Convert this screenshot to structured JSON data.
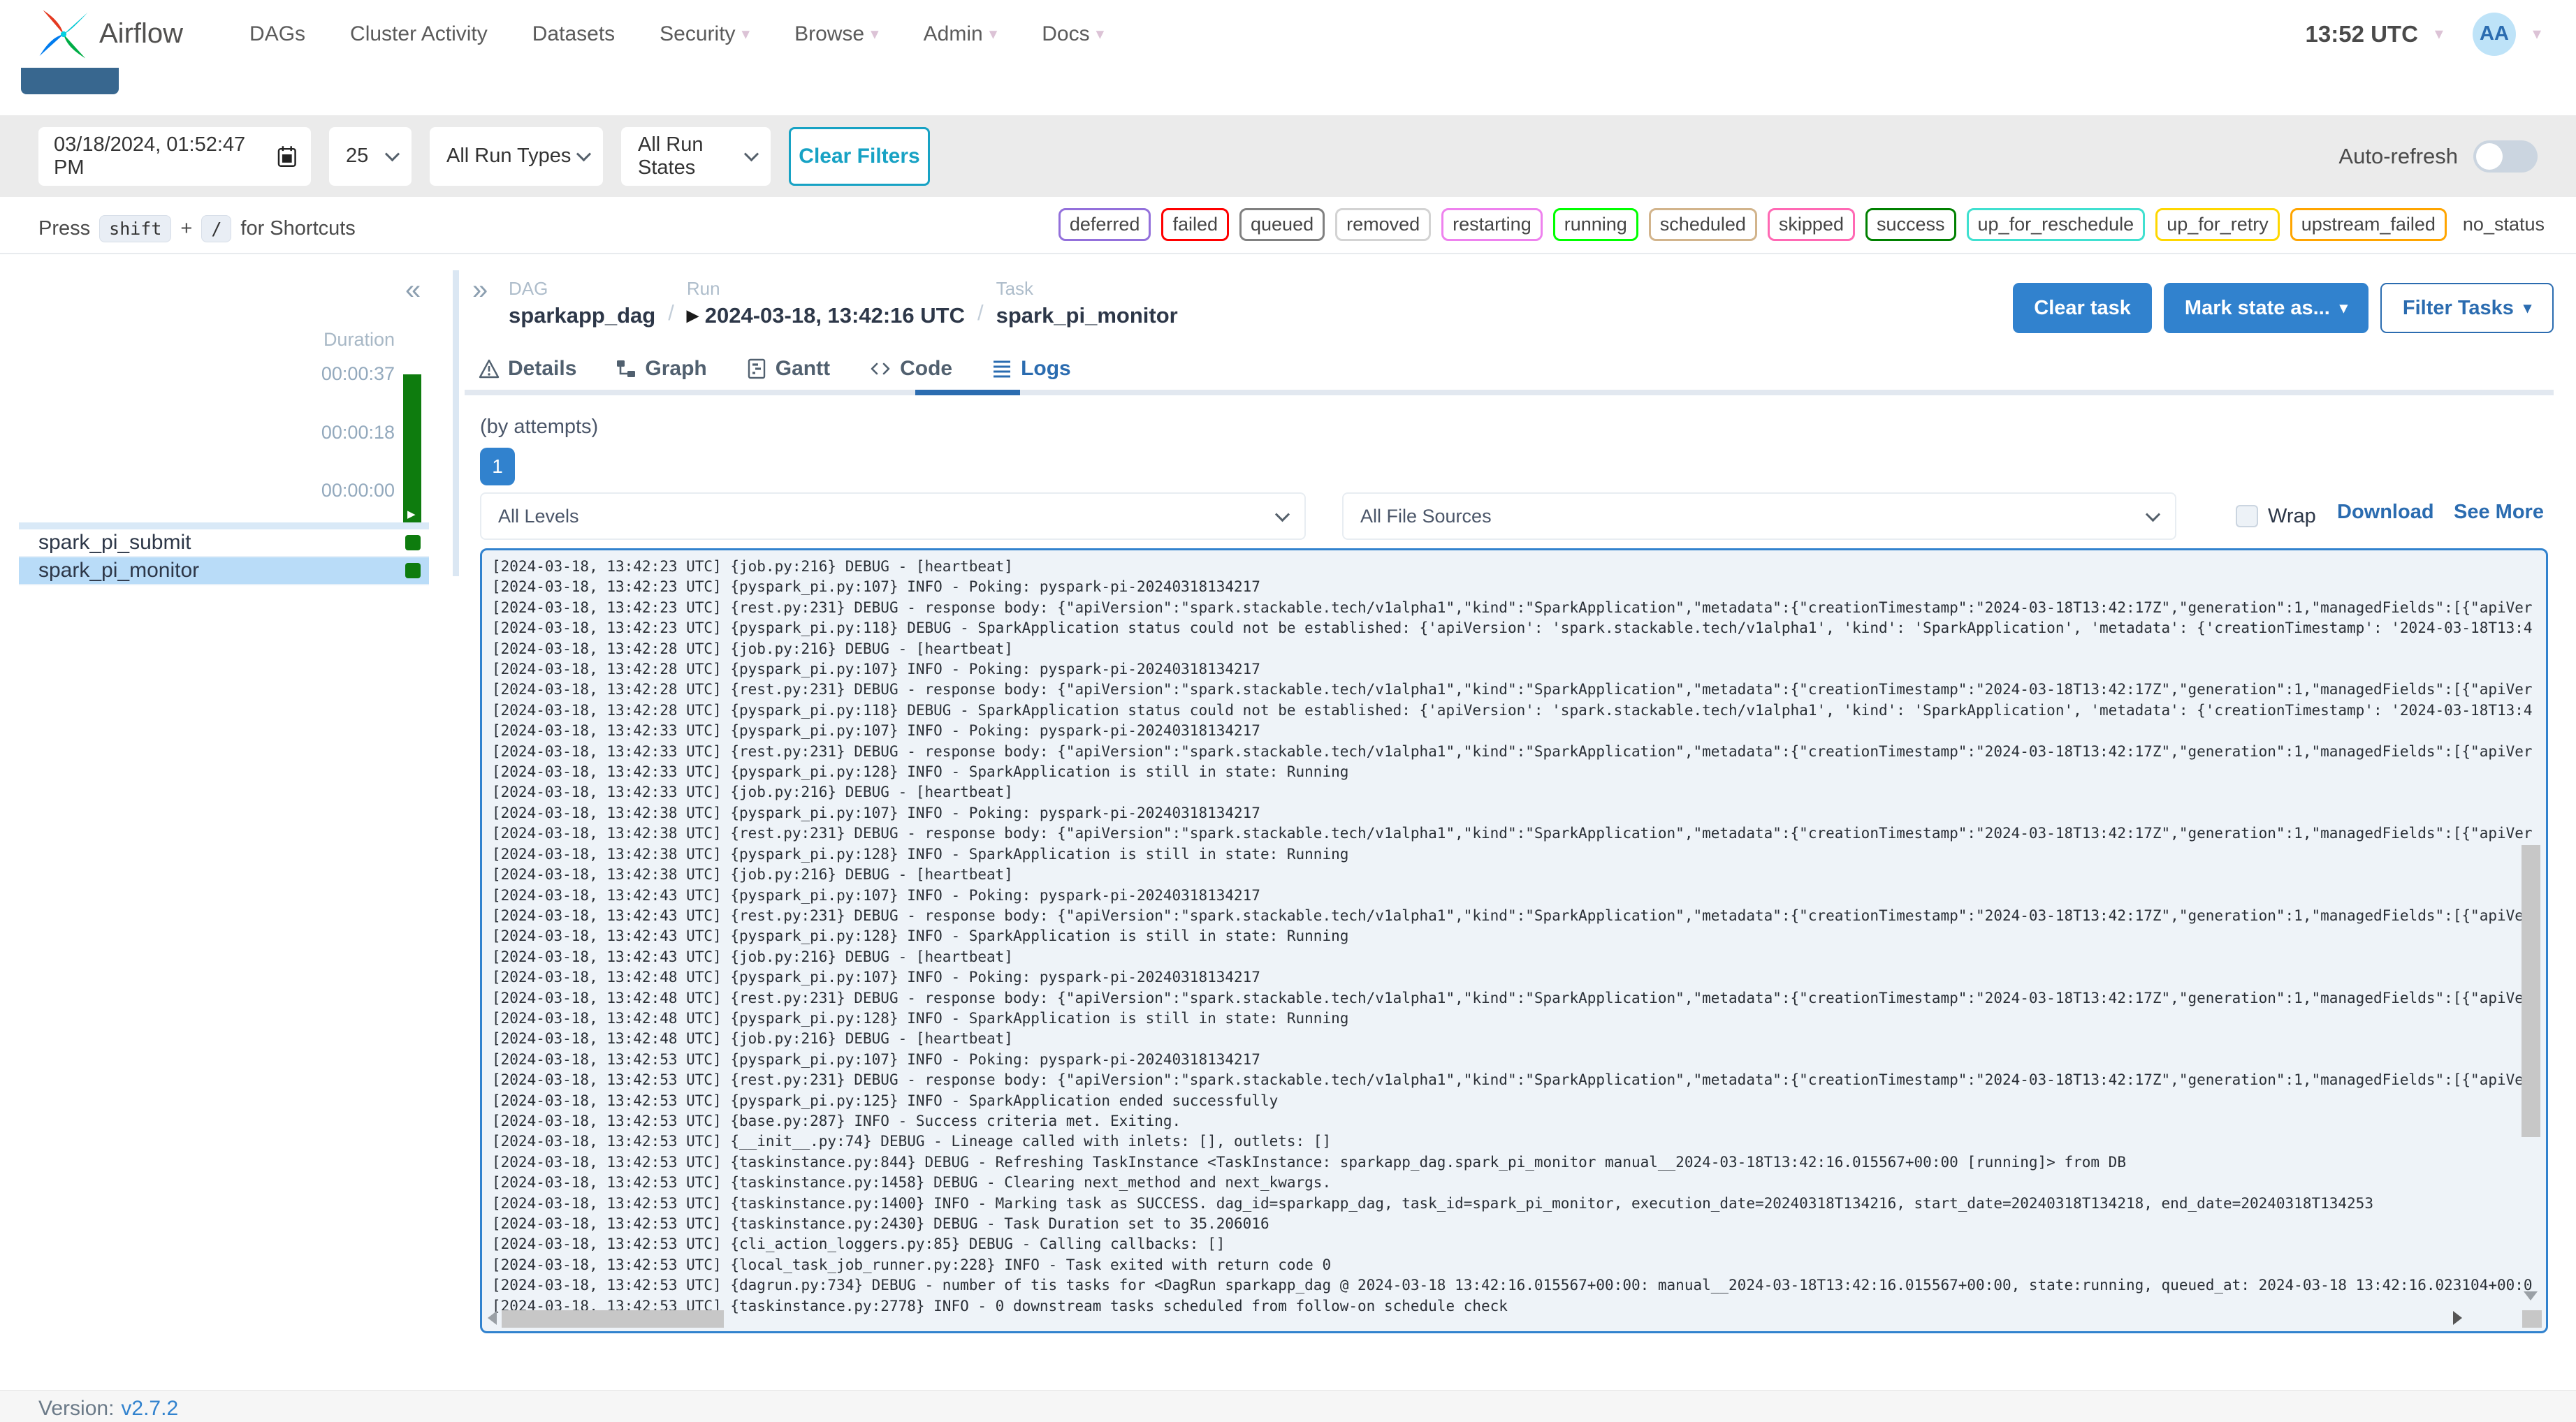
{
  "navbar": {
    "brand": "Airflow",
    "items": [
      {
        "label": "DAGs",
        "caret": false
      },
      {
        "label": "Cluster Activity",
        "caret": false
      },
      {
        "label": "Datasets",
        "caret": false
      },
      {
        "label": "Security",
        "caret": true
      },
      {
        "label": "Browse",
        "caret": true
      },
      {
        "label": "Admin",
        "caret": true
      },
      {
        "label": "Docs",
        "caret": true
      }
    ],
    "clock": "13:52 UTC",
    "avatar_initials": "AA"
  },
  "filters": {
    "date_value": "03/18/2024, 01:52:47 PM",
    "page_size": "25",
    "run_types": "All Run Types",
    "run_states": "All Run States",
    "clear_button": "Clear Filters",
    "auto_refresh_label": "Auto-refresh"
  },
  "shortcuts": {
    "prefix": "Press",
    "key_shift": "shift",
    "plus": "+",
    "key_slash": "/",
    "suffix": "for Shortcuts"
  },
  "legend": {
    "badges": [
      {
        "label": "deferred",
        "color": "#9370DB"
      },
      {
        "label": "failed",
        "color": "#FF0000"
      },
      {
        "label": "queued",
        "color": "#808080"
      },
      {
        "label": "removed",
        "color": "#D3D3D3"
      },
      {
        "label": "restarting",
        "color": "#EE82EE"
      },
      {
        "label": "running",
        "color": "#00FF00"
      },
      {
        "label": "scheduled",
        "color": "#D2B48C"
      },
      {
        "label": "skipped",
        "color": "#FF69B4"
      },
      {
        "label": "success",
        "color": "#008000"
      },
      {
        "label": "up_for_reschedule",
        "color": "#40E0D0"
      },
      {
        "label": "up_for_retry",
        "color": "#FFD700"
      },
      {
        "label": "upstream_failed",
        "color": "#FFA500"
      }
    ],
    "no_status_label": "no_status"
  },
  "sidebar": {
    "duration_label": "Duration",
    "ticks": [
      "00:00:37",
      "00:00:18",
      "00:00:00"
    ],
    "tasks": [
      {
        "name": "spark_pi_submit",
        "selected": false
      },
      {
        "name": "spark_pi_monitor",
        "selected": true
      }
    ]
  },
  "breadcrumb": {
    "dag_label": "DAG",
    "dag_value": "sparkapp_dag",
    "run_label": "Run",
    "run_value": "2024-03-18, 13:42:16 UTC",
    "task_label": "Task",
    "task_value": "spark_pi_monitor",
    "separator": "/"
  },
  "actions": {
    "clear_task": "Clear task",
    "mark_state": "Mark state as...",
    "filter_tasks": "Filter Tasks"
  },
  "tabs": [
    {
      "label": "Details"
    },
    {
      "label": "Graph"
    },
    {
      "label": "Gantt"
    },
    {
      "label": "Code"
    },
    {
      "label": "Logs",
      "active": true
    }
  ],
  "logs_toolbar": {
    "by_attempts": "(by attempts)",
    "attempt": "1",
    "levels": "All Levels",
    "sources": "All File Sources",
    "wrap": "Wrap",
    "download": "Download",
    "see_more": "See More"
  },
  "log_lines": [
    "[2024-03-18, 13:42:23 UTC] {job.py:216} DEBUG - [heartbeat]",
    "[2024-03-18, 13:42:23 UTC] {pyspark_pi.py:107} INFO - Poking: pyspark-pi-20240318134217",
    "[2024-03-18, 13:42:23 UTC] {rest.py:231} DEBUG - response body: {\"apiVersion\":\"spark.stackable.tech/v1alpha1\",\"kind\":\"SparkApplication\",\"metadata\":{\"creationTimestamp\":\"2024-03-18T13:42:17Z\",\"generation\":1,\"managedFields\":[{\"apiVer",
    "[2024-03-18, 13:42:23 UTC] {pyspark_pi.py:118} DEBUG - SparkApplication status could not be established: {'apiVersion': 'spark.stackable.tech/v1alpha1', 'kind': 'SparkApplication', 'metadata': {'creationTimestamp': '2024-03-18T13:4",
    "[2024-03-18, 13:42:28 UTC] {job.py:216} DEBUG - [heartbeat]",
    "[2024-03-18, 13:42:28 UTC] {pyspark_pi.py:107} INFO - Poking: pyspark-pi-20240318134217",
    "[2024-03-18, 13:42:28 UTC] {rest.py:231} DEBUG - response body: {\"apiVersion\":\"spark.stackable.tech/v1alpha1\",\"kind\":\"SparkApplication\",\"metadata\":{\"creationTimestamp\":\"2024-03-18T13:42:17Z\",\"generation\":1,\"managedFields\":[{\"apiVer",
    "[2024-03-18, 13:42:28 UTC] {pyspark_pi.py:118} DEBUG - SparkApplication status could not be established: {'apiVersion': 'spark.stackable.tech/v1alpha1', 'kind': 'SparkApplication', 'metadata': {'creationTimestamp': '2024-03-18T13:4",
    "[2024-03-18, 13:42:33 UTC] {pyspark_pi.py:107} INFO - Poking: pyspark-pi-20240318134217",
    "[2024-03-18, 13:42:33 UTC] {rest.py:231} DEBUG - response body: {\"apiVersion\":\"spark.stackable.tech/v1alpha1\",\"kind\":\"SparkApplication\",\"metadata\":{\"creationTimestamp\":\"2024-03-18T13:42:17Z\",\"generation\":1,\"managedFields\":[{\"apiVer",
    "[2024-03-18, 13:42:33 UTC] {pyspark_pi.py:128} INFO - SparkApplication is still in state: Running",
    "[2024-03-18, 13:42:33 UTC] {job.py:216} DEBUG - [heartbeat]",
    "[2024-03-18, 13:42:38 UTC] {pyspark_pi.py:107} INFO - Poking: pyspark-pi-20240318134217",
    "[2024-03-18, 13:42:38 UTC] {rest.py:231} DEBUG - response body: {\"apiVersion\":\"spark.stackable.tech/v1alpha1\",\"kind\":\"SparkApplication\",\"metadata\":{\"creationTimestamp\":\"2024-03-18T13:42:17Z\",\"generation\":1,\"managedFields\":[{\"apiVer",
    "[2024-03-18, 13:42:38 UTC] {pyspark_pi.py:128} INFO - SparkApplication is still in state: Running",
    "[2024-03-18, 13:42:38 UTC] {job.py:216} DEBUG - [heartbeat]",
    "[2024-03-18, 13:42:43 UTC] {pyspark_pi.py:107} INFO - Poking: pyspark-pi-20240318134217",
    "[2024-03-18, 13:42:43 UTC] {rest.py:231} DEBUG - response body: {\"apiVersion\":\"spark.stackable.tech/v1alpha1\",\"kind\":\"SparkApplication\",\"metadata\":{\"creationTimestamp\":\"2024-03-18T13:42:17Z\",\"generation\":1,\"managedFields\":[{\"apiVer",
    "[2024-03-18, 13:42:43 UTC] {pyspark_pi.py:128} INFO - SparkApplication is still in state: Running",
    "[2024-03-18, 13:42:43 UTC] {job.py:216} DEBUG - [heartbeat]",
    "[2024-03-18, 13:42:48 UTC] {pyspark_pi.py:107} INFO - Poking: pyspark-pi-20240318134217",
    "[2024-03-18, 13:42:48 UTC] {rest.py:231} DEBUG - response body: {\"apiVersion\":\"spark.stackable.tech/v1alpha1\",\"kind\":\"SparkApplication\",\"metadata\":{\"creationTimestamp\":\"2024-03-18T13:42:17Z\",\"generation\":1,\"managedFields\":[{\"apiVer",
    "[2024-03-18, 13:42:48 UTC] {pyspark_pi.py:128} INFO - SparkApplication is still in state: Running",
    "[2024-03-18, 13:42:48 UTC] {job.py:216} DEBUG - [heartbeat]",
    "[2024-03-18, 13:42:53 UTC] {pyspark_pi.py:107} INFO - Poking: pyspark-pi-20240318134217",
    "[2024-03-18, 13:42:53 UTC] {rest.py:231} DEBUG - response body: {\"apiVersion\":\"spark.stackable.tech/v1alpha1\",\"kind\":\"SparkApplication\",\"metadata\":{\"creationTimestamp\":\"2024-03-18T13:42:17Z\",\"generation\":1,\"managedFields\":[{\"apiVer",
    "[2024-03-18, 13:42:53 UTC] {pyspark_pi.py:125} INFO - SparkApplication ended successfully",
    "[2024-03-18, 13:42:53 UTC] {base.py:287} INFO - Success criteria met. Exiting.",
    "[2024-03-18, 13:42:53 UTC] {__init__.py:74} DEBUG - Lineage called with inlets: [], outlets: []",
    "[2024-03-18, 13:42:53 UTC] {taskinstance.py:844} DEBUG - Refreshing TaskInstance <TaskInstance: sparkapp_dag.spark_pi_monitor manual__2024-03-18T13:42:16.015567+00:00 [running]> from DB",
    "[2024-03-18, 13:42:53 UTC] {taskinstance.py:1458} DEBUG - Clearing next_method and next_kwargs.",
    "[2024-03-18, 13:42:53 UTC] {taskinstance.py:1400} INFO - Marking task as SUCCESS. dag_id=sparkapp_dag, task_id=spark_pi_monitor, execution_date=20240318T134216, start_date=20240318T134218, end_date=20240318T134253",
    "[2024-03-18, 13:42:53 UTC] {taskinstance.py:2430} DEBUG - Task Duration set to 35.206016",
    "[2024-03-18, 13:42:53 UTC] {cli_action_loggers.py:85} DEBUG - Calling callbacks: []",
    "[2024-03-18, 13:42:53 UTC] {local_task_job_runner.py:228} INFO - Task exited with return code 0",
    "[2024-03-18, 13:42:53 UTC] {dagrun.py:734} DEBUG - number of tis tasks for <DagRun sparkapp_dag @ 2024-03-18 13:42:16.015567+00:00: manual__2024-03-18T13:42:16.015567+00:00, state:running, queued_at: 2024-03-18 13:42:16.023104+00:0",
    "[2024-03-18, 13:42:53 UTC] {taskinstance.py:2778} INFO - 0 downstream tasks scheduled from follow-on schedule check"
  ],
  "footer": {
    "version_label": "Version:",
    "version_link": "v2.7.2"
  },
  "colors": {
    "accent_blue": "#3182ce",
    "active_tab_blue": "#2b6cb0",
    "selected_row_blue": "#b9dcf8",
    "duration_bar_green": "#0e7c0e",
    "clear_filters_teal": "#17a2c4"
  }
}
